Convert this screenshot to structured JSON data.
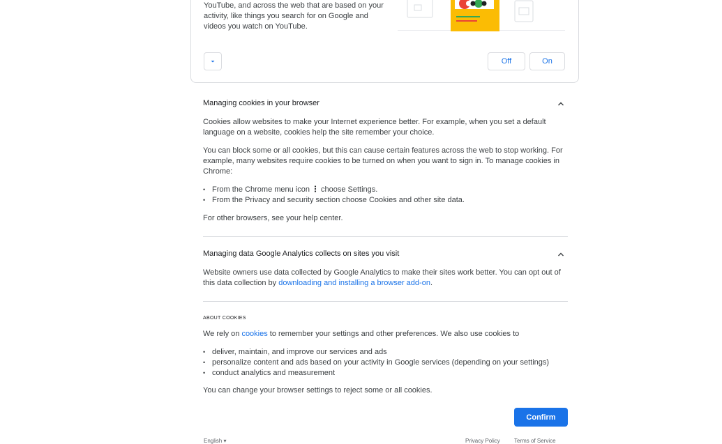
{
  "top_card": {
    "text": "YouTube, and across the web that are based on your activity, like things you search for on Google and videos you watch on YouTube.",
    "off_label": "Off",
    "on_label": "On"
  },
  "cookies_section": {
    "title": "Managing cookies in your browser",
    "para1": "Cookies allow websites to make your Internet experience better. For example, when you set a default language on a website, cookies help the site remember your choice.",
    "para2": "You can block some or all cookies, but this can cause certain features across the web to stop working. For example, many websites require cookies to be turned on when you want to sign in. To manage cookies in Chrome:",
    "bullet1_pre": "From the Chrome menu icon",
    "bullet1_post": "choose Settings.",
    "bullet2": "From the Privacy and security section choose Cookies and other site data.",
    "para3": "For other browsers, see your help center."
  },
  "analytics_section": {
    "title": "Managing data Google Analytics collects on sites you visit",
    "text_pre": "Website owners use data collected by Google Analytics to make their sites work better. You can opt out of this data collection by ",
    "link": "downloading and installing a browser add-on",
    "text_post": "."
  },
  "about": {
    "heading": "ABOUT COOKIES",
    "intro_pre": "We rely on ",
    "intro_link": "cookies",
    "intro_post": " to remember your settings and other preferences. We also use cookies to",
    "bullets": [
      "deliver, maintain, and improve our services and ads",
      "personalize content and ads based on your activity in Google services (depending on your settings)",
      "conduct analytics and measurement"
    ],
    "closing": "You can change your browser settings to reject some or all cookies.",
    "confirm_label": "Confirm"
  },
  "footer": {
    "language": "English",
    "privacy": "Privacy Policy",
    "terms": "Terms of Service"
  }
}
